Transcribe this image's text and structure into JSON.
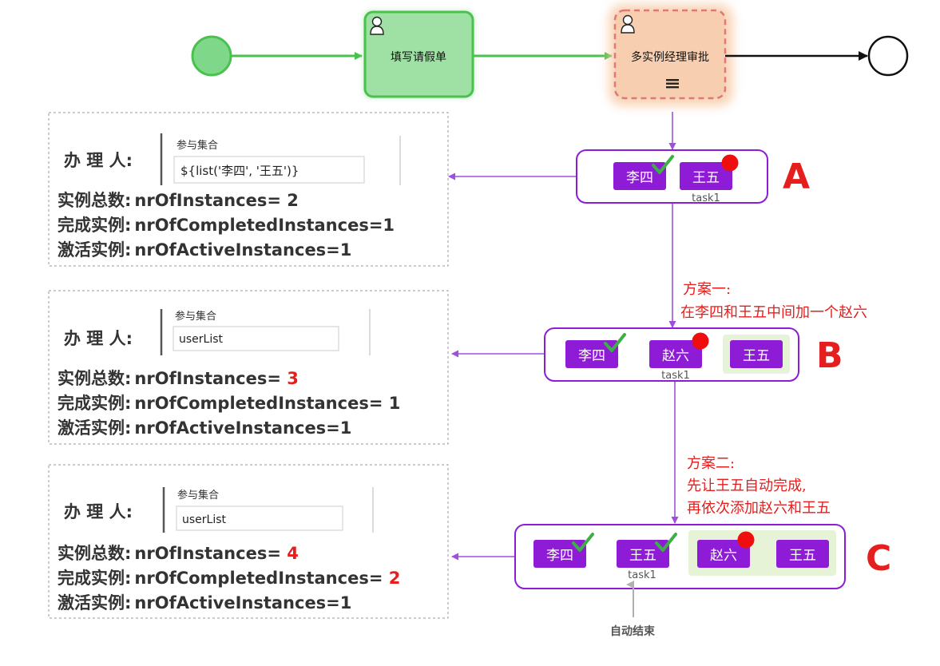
{
  "flow": {
    "task_fill": "填写请假单",
    "task_approve": "多实例经理审批",
    "multi_instance_marker": "≡"
  },
  "panels": [
    {
      "handler_label": "办 理 人:",
      "collection_label": "参与集合",
      "collection_value": "${list('李四', '王五')}",
      "total_label": "实例总数:",
      "total_expr": "nrOfInstances= ",
      "total_value": "2",
      "completed_label": "完成实例:",
      "completed_expr": "nrOfCompletedInstances=",
      "completed_value": "1",
      "active_label": "激活实例:",
      "active_expr": "nrOfActiveInstances=1"
    },
    {
      "handler_label": "办 理 人:",
      "collection_label": "参与集合",
      "collection_value": "userList",
      "total_label": "实例总数:",
      "total_expr": "nrOfInstances= ",
      "total_value": "3",
      "completed_label": "完成实例:",
      "completed_expr": "nrOfCompletedInstances= ",
      "completed_value": "1",
      "active_label": "激活实例:",
      "active_expr": "nrOfActiveInstances=1"
    },
    {
      "handler_label": "办 理 人:",
      "collection_label": "参与集合",
      "collection_value": "userList",
      "total_label": "实例总数:",
      "total_expr": "nrOfInstances= ",
      "total_value": "4",
      "completed_label": "完成实例:",
      "completed_expr": "nrOfCompletedInstances= ",
      "completed_value": "2",
      "active_label": "激活实例:",
      "active_expr": "nrOfActiveInstances=1"
    }
  ],
  "groups": {
    "A": {
      "letter": "A",
      "chips": [
        "李四",
        "王五"
      ],
      "task_label": "task1"
    },
    "B": {
      "letter": "B",
      "chips": [
        "李四",
        "赵六",
        "王五"
      ],
      "task_label": "task1"
    },
    "C": {
      "letter": "C",
      "chips": [
        "李四",
        "王五",
        "赵六",
        "王五"
      ],
      "task_label": "task1"
    }
  },
  "notes": {
    "plan1_title": "方案一:",
    "plan1_body": "在李四和王五中间加一个赵六",
    "plan2_title": "方案二:",
    "plan2_line1": "先让王五自动完成,",
    "plan2_line2": "再依次添加赵六和王五",
    "auto_end": "自动结束"
  },
  "colors": {
    "purple": "#8e1cd6",
    "purple_line": "#a04ee0",
    "green_line": "#49c24d",
    "green_fill": "#9fe0a4",
    "orange_fill": "#f7cfb0",
    "red": "#e51e1e",
    "check": "#3cb043",
    "highlight": "#e6f3d6"
  }
}
